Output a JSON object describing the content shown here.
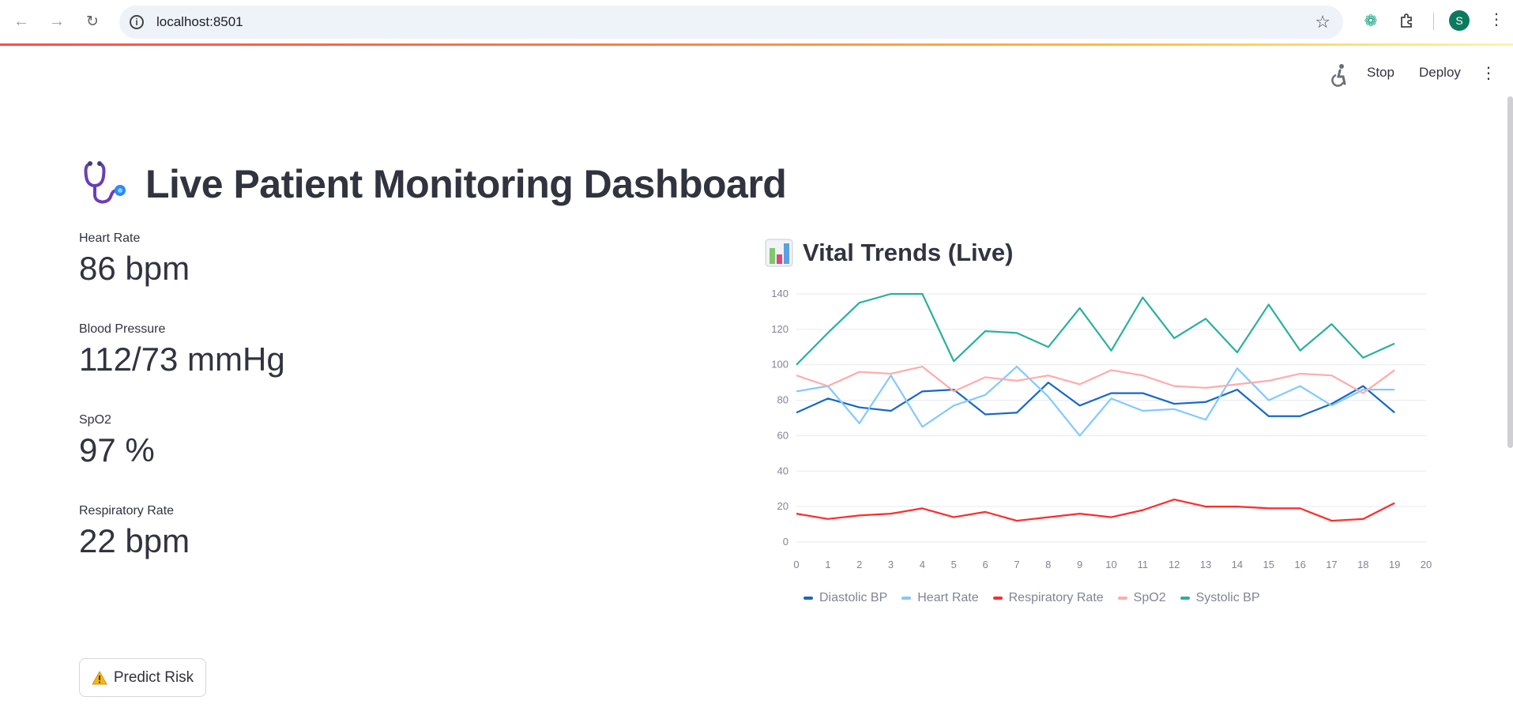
{
  "browser": {
    "url": "localhost:8501",
    "avatar_letter": "S"
  },
  "header": {
    "stop_label": "Stop",
    "deploy_label": "Deploy"
  },
  "page": {
    "title": "Live Patient Monitoring Dashboard",
    "title_icon": "stethoscope-icon"
  },
  "metrics": [
    {
      "label": "Heart Rate",
      "value": "86 bpm"
    },
    {
      "label": "Blood Pressure",
      "value": "112/73 mmHg"
    },
    {
      "label": "SpO2",
      "value": "97 %"
    },
    {
      "label": "Respiratory Rate",
      "value": "22 bpm"
    }
  ],
  "predict_button": {
    "label": "Predict Risk",
    "icon": "warning-icon"
  },
  "trends": {
    "title": "Vital Trends (Live)",
    "icon": "bar-chart-icon"
  },
  "chart_data": {
    "type": "line",
    "title": "Vital Trends (Live)",
    "xlabel": "",
    "ylabel": "",
    "x": [
      0,
      1,
      2,
      3,
      4,
      5,
      6,
      7,
      8,
      9,
      10,
      11,
      12,
      13,
      14,
      15,
      16,
      17,
      18,
      19
    ],
    "xlim": [
      0,
      20
    ],
    "xticks": [
      0,
      1,
      2,
      3,
      4,
      5,
      6,
      7,
      8,
      9,
      10,
      11,
      12,
      13,
      14,
      15,
      16,
      17,
      18,
      19,
      20
    ],
    "ylim": [
      0,
      140
    ],
    "yticks": [
      0,
      20,
      40,
      60,
      80,
      100,
      120,
      140
    ],
    "grid": true,
    "legend_position": "bottom",
    "series": [
      {
        "name": "Diastolic BP",
        "color": "#1668c7",
        "values": [
          73,
          81,
          76,
          74,
          85,
          86,
          72,
          73,
          90,
          77,
          84,
          84,
          78,
          79,
          86,
          71,
          71,
          78,
          88,
          73
        ]
      },
      {
        "name": "Heart Rate",
        "color": "#83c9ff",
        "values": [
          85,
          88,
          67,
          94,
          65,
          77,
          83,
          99,
          82,
          60,
          81,
          74,
          75,
          69,
          98,
          80,
          88,
          77,
          86,
          86
        ]
      },
      {
        "name": "Respiratory Rate",
        "color": "#ff2b2b",
        "values": [
          16,
          13,
          15,
          16,
          19,
          14,
          17,
          12,
          14,
          16,
          14,
          18,
          24,
          20,
          20,
          19,
          19,
          12,
          13,
          22
        ]
      },
      {
        "name": "SpO2",
        "color": "#ffabab",
        "values": [
          94,
          88,
          96,
          95,
          99,
          85,
          93,
          91,
          94,
          89,
          97,
          94,
          88,
          87,
          89,
          91,
          95,
          94,
          84,
          97
        ]
      },
      {
        "name": "Systolic BP",
        "color": "#29b09d",
        "values": [
          100,
          118,
          135,
          140,
          140,
          102,
          119,
          118,
          110,
          132,
          108,
          138,
          115,
          126,
          107,
          134,
          108,
          123,
          104,
          112
        ]
      }
    ]
  }
}
